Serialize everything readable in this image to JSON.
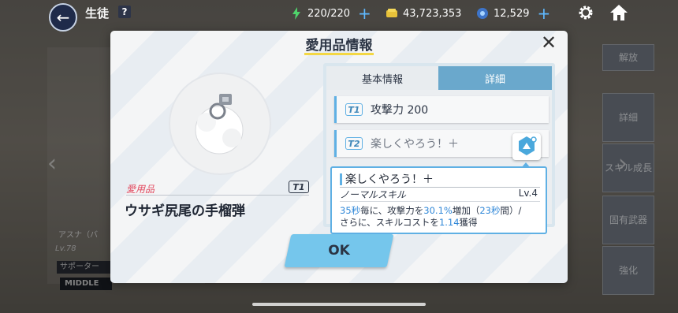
{
  "topbar": {
    "title": "生徒",
    "help": "?",
    "ap": "220/220",
    "credits": "43,723,353",
    "gems": "12,529",
    "plus": "+"
  },
  "background": {
    "right_buttons": [
      "解放",
      "詳細",
      "スキル成長",
      "固有武器",
      "強化"
    ],
    "char_name": "アスナ（バ",
    "char_level": "Lv.78",
    "char_role": "サポーター",
    "char_position": "MIDDLE"
  },
  "modal": {
    "title": "愛用品情報",
    "close": "✕",
    "item_category": "愛用品",
    "item_tier": "T1",
    "item_name": "ウサギ尻尾の手榴弾",
    "tabs": [
      {
        "label": "基本情報",
        "active": true
      },
      {
        "label": "詳細",
        "active": false
      }
    ],
    "skills": [
      {
        "tier": "T1",
        "text": "攻撃力 200"
      },
      {
        "tier": "T2",
        "text": "楽しくやろう！＋"
      }
    ],
    "ok_label": "OK"
  },
  "tooltip": {
    "name": "楽しくやろう！＋",
    "type": "ノーマルスキル",
    "level": "Lv.4",
    "desc_parts": {
      "p1": "35秒",
      "p2": "毎に、攻撃力を",
      "p3": "30.1%",
      "p4": "増加（",
      "p5": "23秒",
      "p6": "間）/",
      "p7": "さらに、スキルコストを",
      "p8": "1.14",
      "p9": "獲得"
    }
  },
  "colors": {
    "accent": "#5fb0e4",
    "highlight": "#2f87d8",
    "title_underline": "#f3d743",
    "category": "#e2495f",
    "ok_button": "#75c6ec"
  }
}
